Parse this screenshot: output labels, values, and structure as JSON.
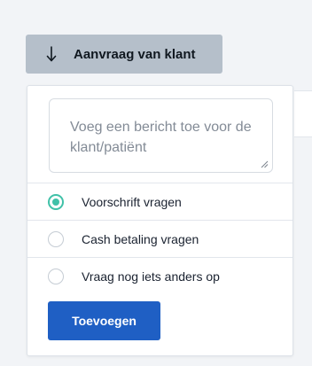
{
  "dropdown": {
    "label": "Aanvraag van klant",
    "icon": "arrow-down-icon"
  },
  "message": {
    "placeholder": "Voeg een bericht toe voor de klant/patiënt",
    "value": ""
  },
  "options": [
    {
      "label": "Voorschrift vragen",
      "checked": true
    },
    {
      "label": "Cash betaling vragen",
      "checked": false
    },
    {
      "label": "Vraag nog iets anders op",
      "checked": false
    }
  ],
  "submit": {
    "label": "Toevoegen"
  },
  "colors": {
    "accent": "#40c1a8",
    "primary_button": "#1f5fc4",
    "dropdown_bg": "#b5bfca"
  }
}
